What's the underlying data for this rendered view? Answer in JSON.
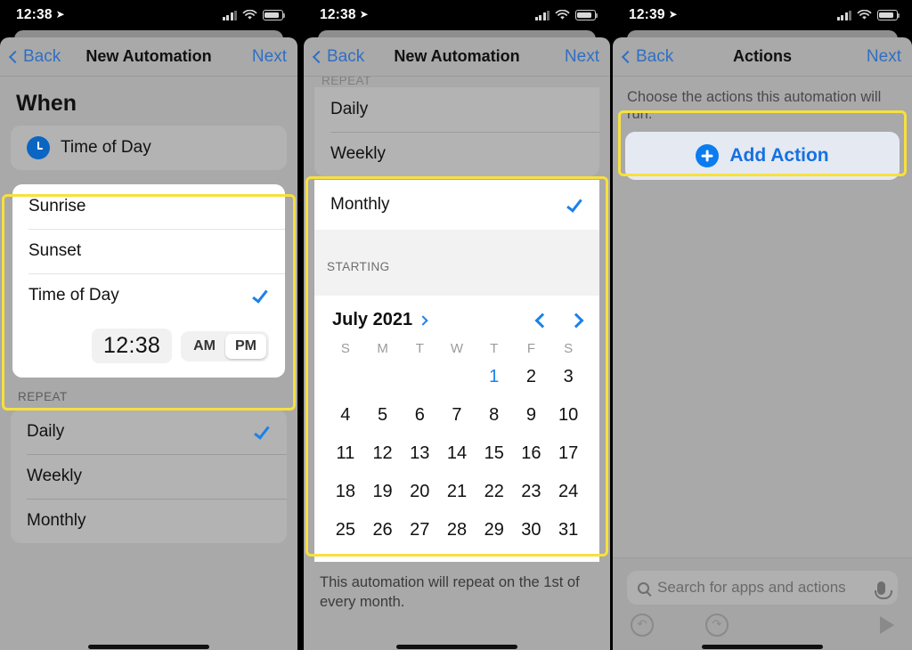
{
  "panels": [
    {
      "status": {
        "time": "12:38",
        "location_icon": "location-arrow-icon",
        "cellular_icon": "cellular-bars-icon",
        "wifi_icon": "wifi-icon",
        "battery_icon": "battery-icon"
      },
      "nav": {
        "back": "Back",
        "title": "New Automation",
        "next": "Next"
      },
      "when_header": "When",
      "trigger": {
        "icon": "clock-icon",
        "label": "Time of Day"
      },
      "time_options": [
        {
          "label": "Sunrise",
          "selected": false
        },
        {
          "label": "Sunset",
          "selected": false
        },
        {
          "label": "Time of Day",
          "selected": true
        }
      ],
      "time_picker": {
        "value": "12:38",
        "am_label": "AM",
        "pm_label": "PM",
        "selected_meridiem": "PM"
      },
      "repeat_header": "REPEAT",
      "repeat_options": [
        {
          "label": "Daily",
          "selected": true
        },
        {
          "label": "Weekly",
          "selected": false
        },
        {
          "label": "Monthly",
          "selected": false
        }
      ]
    },
    {
      "status": {
        "time": "12:38"
      },
      "nav": {
        "back": "Back",
        "title": "New Automation",
        "next": "Next"
      },
      "repeat_header": "REPEAT",
      "repeat_options": [
        {
          "label": "Daily",
          "selected": false
        },
        {
          "label": "Weekly",
          "selected": false
        },
        {
          "label": "Monthly",
          "selected": true
        }
      ],
      "starting_header": "STARTING",
      "calendar": {
        "month_label": "July 2021",
        "prev_icon": "chevron-left-icon",
        "next_icon": "chevron-right-icon",
        "expand_icon": "chevron-right-icon",
        "weekdays": [
          "S",
          "M",
          "T",
          "W",
          "T",
          "F",
          "S"
        ],
        "leading_blanks": 4,
        "days": [
          1,
          2,
          3,
          4,
          5,
          6,
          7,
          8,
          9,
          10,
          11,
          12,
          13,
          14,
          15,
          16,
          17,
          18,
          19,
          20,
          21,
          22,
          23,
          24,
          25,
          26,
          27,
          28,
          29,
          30,
          31
        ],
        "selected_day": 1
      },
      "footer_note": "This automation will repeat on the 1st of every month."
    },
    {
      "status": {
        "time": "12:39"
      },
      "nav": {
        "back": "Back",
        "title": "Actions",
        "next": "Next"
      },
      "subtitle": "Choose the actions this automation will run.",
      "add_action": {
        "label": "Add Action",
        "icon": "plus-circle-icon"
      },
      "search": {
        "placeholder": "Search for apps and actions",
        "search_icon": "search-icon",
        "mic_icon": "microphone-icon"
      },
      "toolbar": {
        "undo_icon": "undo-icon",
        "redo_icon": "redo-icon",
        "play_icon": "play-icon"
      }
    }
  ],
  "highlight_color": "#f7e03d"
}
